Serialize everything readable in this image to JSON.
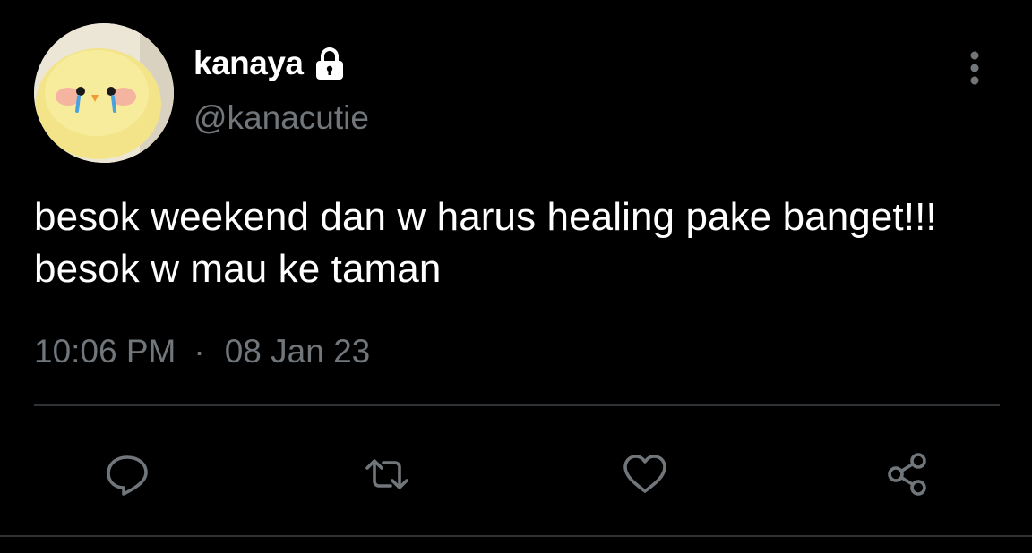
{
  "user": {
    "display_name": "kanaya",
    "handle": "@kanacutie",
    "protected_icon": "lock-icon",
    "avatar": "yellow-plush-chick-crying"
  },
  "tweet": {
    "text": "besok weekend dan w harus healing pake banget!!! besok w mau ke taman",
    "time": "10:06 PM",
    "separator": "·",
    "date": "08 Jan 23"
  },
  "actions": [
    {
      "name": "reply",
      "icon": "speech-bubble-icon"
    },
    {
      "name": "retweet",
      "icon": "retweet-arrows-icon"
    },
    {
      "name": "like",
      "icon": "heart-icon"
    },
    {
      "name": "share",
      "icon": "share-nodes-icon"
    }
  ],
  "colors": {
    "background": "#000000",
    "primary_text": "#ffffff",
    "secondary_text": "#71767b",
    "divider": "#2f3336"
  }
}
